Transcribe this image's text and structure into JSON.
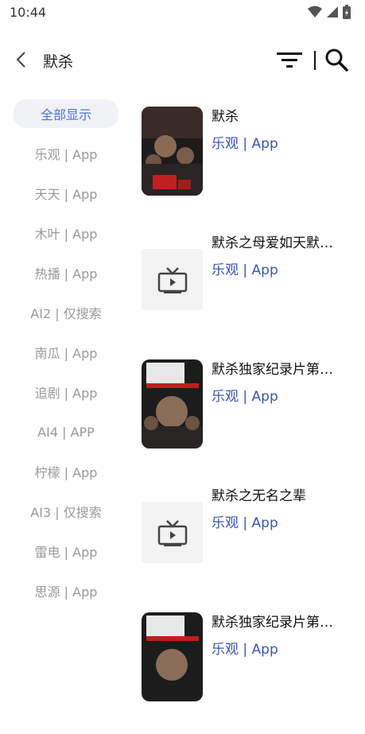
{
  "status": {
    "time": "10:44"
  },
  "header": {
    "title": "默杀"
  },
  "sidebar": {
    "items": [
      {
        "label": "全部显示"
      },
      {
        "label": "乐观 | App"
      },
      {
        "label": "天天 | App"
      },
      {
        "label": "木叶 | App"
      },
      {
        "label": "热播 | App"
      },
      {
        "label": "AI2 | 仅搜索"
      },
      {
        "label": "南瓜 | App"
      },
      {
        "label": "追剧 | App"
      },
      {
        "label": "AI4 | APP"
      },
      {
        "label": "柠檬 | App"
      },
      {
        "label": "AI3 | 仅搜索"
      },
      {
        "label": "雷电 | App"
      },
      {
        "label": "思源 | App"
      }
    ]
  },
  "results": [
    {
      "title": "默杀",
      "source": "乐观 | App",
      "thumb": "poster"
    },
    {
      "title": "默杀之母爱如天默…",
      "source": "乐观 | App",
      "thumb": "tv-icon"
    },
    {
      "title": "默杀独家纪录片第…",
      "source": "乐观 | App",
      "thumb": "poster"
    },
    {
      "title": "默杀之无名之辈",
      "source": "乐观 | App",
      "thumb": "tv-icon"
    },
    {
      "title": "默杀独家纪录片第…",
      "source": "乐观 | App",
      "thumb": "poster"
    }
  ],
  "colors": {
    "accent": "#4a73e8",
    "source_link": "#3a55b5"
  }
}
